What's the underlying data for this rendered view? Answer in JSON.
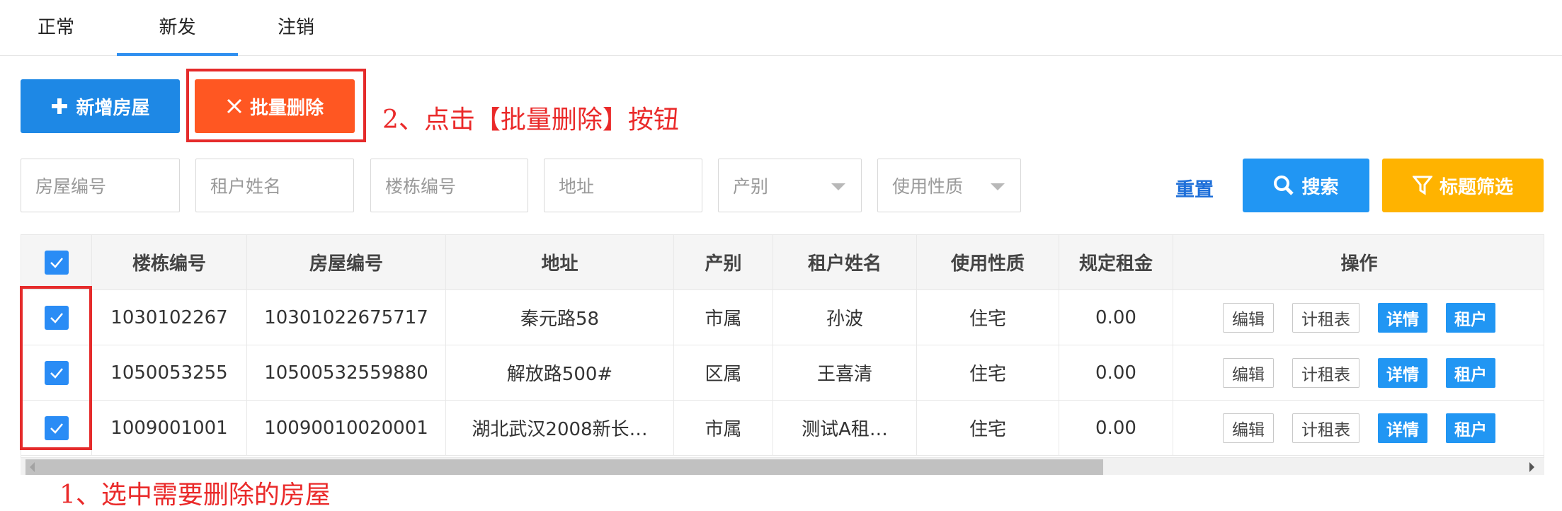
{
  "tabs": [
    {
      "label": "正常",
      "active": false
    },
    {
      "label": "新发",
      "active": true
    },
    {
      "label": "注销",
      "active": false
    }
  ],
  "toolbar": {
    "add_label": "新增房屋",
    "batch_delete_label": "批量删除"
  },
  "annotations": {
    "step2": "2、点击【批量删除】按钮",
    "step1": "1、选中需要删除的房屋"
  },
  "filters": {
    "house_no": "房屋编号",
    "tenant_name": "租户姓名",
    "building_no": "楼栋编号",
    "address": "地址",
    "property_type": "产别",
    "usage": "使用性质",
    "reset_label": "重置",
    "search_label": "搜索",
    "title_filter_label": "标题筛选"
  },
  "table": {
    "headers": [
      "楼栋编号",
      "房屋编号",
      "地址",
      "产别",
      "租户姓名",
      "使用性质",
      "规定租金",
      "操作"
    ],
    "rows": [
      {
        "building_no": "1030102267",
        "house_no": "10301022675717",
        "address": "秦元路58",
        "property_type": "市属",
        "tenant": "孙波",
        "usage": "住宅",
        "rent": "0.00",
        "checked": true
      },
      {
        "building_no": "1050053255",
        "house_no": "10500532559880",
        "address": "解放路500#",
        "property_type": "区属",
        "tenant": "王喜清",
        "usage": "住宅",
        "rent": "0.00",
        "checked": true
      },
      {
        "building_no": "1009001001",
        "house_no": "10090010020001",
        "address": "湖北武汉2008新长…",
        "property_type": "市属",
        "tenant": "测试A租…",
        "usage": "住宅",
        "rent": "0.00",
        "checked": true
      }
    ],
    "actions": [
      "编辑",
      "计租表",
      "详情",
      "租户"
    ]
  },
  "colors": {
    "primary": "#1e88e5",
    "danger": "#ff5722",
    "warning": "#ffb300",
    "annotation": "#e52b2b"
  }
}
